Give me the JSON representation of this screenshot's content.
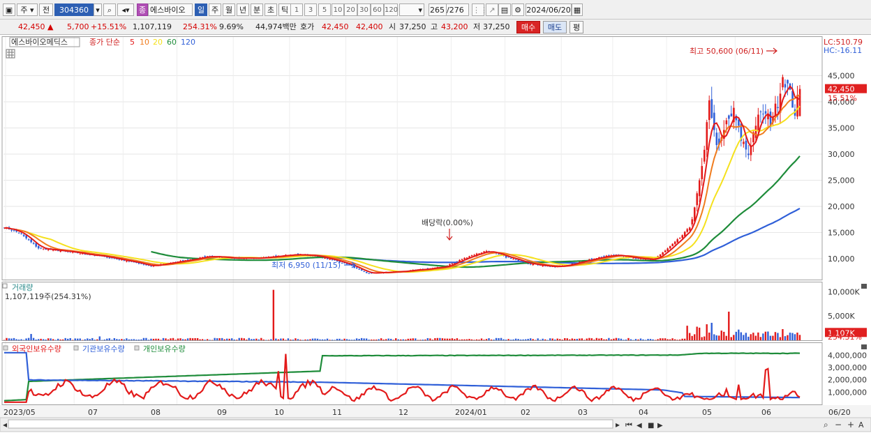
{
  "toolbar": {
    "market": "주",
    "scope": "전",
    "code": "304360",
    "stock_badge": "종",
    "stock_name": "에스바이오",
    "periods": [
      "일",
      "주",
      "월",
      "년",
      "분",
      "초",
      "틱"
    ],
    "selected_period": "일",
    "intervals": [
      "1",
      "3",
      "5",
      "10",
      "20",
      "30",
      "60",
      "120"
    ],
    "count": "265",
    "total": "/276",
    "date": "2024/06/20"
  },
  "quote": {
    "price": "42,450",
    "change": "5,700",
    "change_pct": "+15.51%",
    "volume": "1,107,119",
    "volume_ratio": "254.31%",
    "turnover": "9.69%",
    "amount": "44,974백만",
    "hoga_label": "호가",
    "ask": "42,450",
    "bid": "42,400",
    "open_label": "시",
    "open": "37,250",
    "high_label": "고",
    "high": "43,200",
    "low_label": "저",
    "low": "37,250",
    "buy_label": "매수",
    "sell_label": "매도",
    "eval_label": "평"
  },
  "chart_data": [
    {
      "type": "candlestick",
      "title": "에스바이오메딕스",
      "ma_legend": [
        "종가 단순",
        "5",
        "10",
        "20",
        "60",
        "120"
      ],
      "ma_colors": {
        "5": "#e31a1a",
        "10": "#f07c1e",
        "20": "#f5e11d",
        "60": "#1e8c3a",
        "120": "#2f5fd8"
      },
      "ylim": [
        6000,
        52000
      ],
      "yticks": [
        "10,000",
        "15,000",
        "20,000",
        "25,000",
        "30,000",
        "35,000",
        "40,000",
        "45,000"
      ],
      "lc_label": "LC:510.79",
      "hc_label": "HC:-16.11",
      "last_price": "42,450",
      "last_pct": "15.51%",
      "annot_high": "최고 50,600 (06/11)",
      "annot_low": "최저 6,950 (11/15)",
      "annot_dividend": "배당락(0.00%)",
      "close_anchors": [
        [
          0,
          16000
        ],
        [
          6,
          15000
        ],
        [
          14,
          12000
        ],
        [
          28,
          11200
        ],
        [
          42,
          10300
        ],
        [
          52,
          9400
        ],
        [
          60,
          8600
        ],
        [
          72,
          9500
        ],
        [
          84,
          10500
        ],
        [
          96,
          10000
        ],
        [
          108,
          10300
        ],
        [
          118,
          10800
        ],
        [
          128,
          10500
        ],
        [
          140,
          9000
        ],
        [
          148,
          7200
        ],
        [
          160,
          7500
        ],
        [
          170,
          7900
        ],
        [
          180,
          8500
        ],
        [
          190,
          10500
        ],
        [
          197,
          11500
        ],
        [
          205,
          10300
        ],
        [
          215,
          9000
        ],
        [
          225,
          8400
        ],
        [
          232,
          9000
        ],
        [
          240,
          10000
        ],
        [
          250,
          10800
        ],
        [
          258,
          10000
        ],
        [
          265,
          9800
        ],
        [
          270,
          11500
        ],
        [
          276,
          14000
        ],
        [
          280,
          16000
        ],
        [
          283,
          22000
        ],
        [
          286,
          30000
        ],
        [
          288,
          41000
        ],
        [
          290,
          34000
        ],
        [
          292,
          31000
        ],
        [
          295,
          36000
        ],
        [
          298,
          38000
        ],
        [
          301,
          33000
        ],
        [
          304,
          30000
        ],
        [
          307,
          36000
        ],
        [
          310,
          38000
        ],
        [
          313,
          36000
        ],
        [
          316,
          40000
        ],
        [
          318,
          45000
        ],
        [
          320,
          43000
        ],
        [
          323,
          38000
        ],
        [
          325,
          42450
        ]
      ],
      "ma_start": {
        "60": 60,
        "120": 132
      }
    },
    {
      "type": "bar",
      "title": "거래량",
      "info": "1,107,119주(254.31%)",
      "yticks": [
        "10,000K",
        "5,000K"
      ],
      "ylim": [
        0,
        11500
      ],
      "last_label": "1,107K",
      "last_pct": "254.31%",
      "spikes": [
        [
          11,
          1300
        ],
        [
          39,
          800
        ],
        [
          110,
          10400
        ],
        [
          279,
          3000
        ],
        [
          283,
          2800
        ],
        [
          284,
          2600
        ],
        [
          287,
          3300
        ],
        [
          289,
          3600
        ],
        [
          293,
          2000
        ],
        [
          296,
          5900
        ],
        [
          300,
          2200
        ],
        [
          308,
          1600
        ],
        [
          312,
          1800
        ],
        [
          318,
          2300
        ],
        [
          322,
          1500
        ],
        [
          325,
          1107
        ]
      ]
    },
    {
      "type": "line",
      "legend": [
        "외국인보유수량",
        "기관보유수량",
        "개인보유수량"
      ],
      "colors": [
        "#e31a1a",
        "#2f5fd8",
        "#1e8c3a"
      ],
      "ylim": [
        0,
        4700000
      ],
      "yticks": [
        "4,000,000",
        "3,000,000",
        "2,000,000",
        "1,000,000"
      ],
      "x_labels": [
        "2023/05",
        "07",
        "08",
        "09",
        "10",
        "11",
        "12",
        "2024/01",
        "02",
        "03",
        "04",
        "05",
        "06"
      ],
      "last_date": "06/20"
    }
  ]
}
